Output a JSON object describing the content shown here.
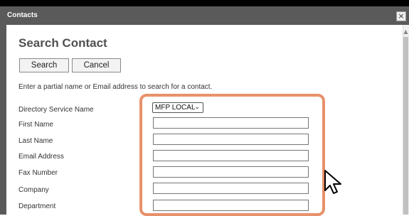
{
  "window": {
    "title": "Contacts",
    "close_symbol": "×"
  },
  "page": {
    "heading": "Search Contact",
    "search_label": "Search",
    "cancel_label": "Cancel",
    "instructions": "Enter a partial name or Email address to search for a contact."
  },
  "form": {
    "directory_label": "Directory Service Name",
    "directory_value": "MFP LOCAL",
    "first_name_label": "First Name",
    "first_name_value": "",
    "last_name_label": "Last Name",
    "last_name_value": "",
    "email_label": "Email Address",
    "email_value": "",
    "fax_label": "Fax Number",
    "fax_value": "",
    "company_label": "Company",
    "company_value": "",
    "department_label": "Department",
    "department_value": ""
  },
  "annotation": {
    "highlight_color": "#e8916a"
  },
  "icons": {
    "close": "close-icon",
    "dropdown": "chevron-down-icon",
    "scroll_up": "scroll-up-arrow-icon",
    "cursor": "mouse-pointer-icon"
  },
  "colors": {
    "titlebar": "#5a5a5a",
    "heading": "#505050"
  }
}
